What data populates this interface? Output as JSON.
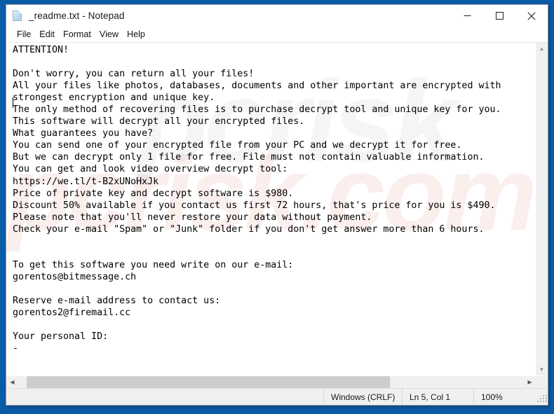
{
  "window": {
    "title": "_readme.txt - Notepad",
    "icon": "notepad-document-icon",
    "controls": {
      "minimize_label": "Minimize",
      "maximize_label": "Maximize",
      "close_label": "Close"
    }
  },
  "menu": {
    "items": [
      {
        "label": "File"
      },
      {
        "label": "Edit"
      },
      {
        "label": "Format"
      },
      {
        "label": "View"
      },
      {
        "label": "Help"
      }
    ]
  },
  "editor": {
    "watermark": "pcrisk.com",
    "watermark_back": "pcrisk",
    "content": "ATTENTION!\n\nDon't worry, you can return all your files!\nAll your files like photos, databases, documents and other important are encrypted with\nstrongest encryption and unique key.\nThe only method of recovering files is to purchase decrypt tool and unique key for you.\nThis software will decrypt all your encrypted files.\nWhat guarantees you have?\nYou can send one of your encrypted file from your PC and we decrypt it for free.\nBut we can decrypt only 1 file for free. File must not contain valuable information.\nYou can get and look video overview decrypt tool:\nhttps://we.tl/t-B2xUNoHxJk\nPrice of private key and decrypt software is $980.\nDiscount 50% available if you contact us first 72 hours, that's price for you is $490.\nPlease note that you'll never restore your data without payment.\nCheck your e-mail \"Spam\" or \"Junk\" folder if you don't get answer more than 6 hours.\n\n\nTo get this software you need write on our e-mail:\ngorentos@bitmessage.ch\n\nReserve e-mail address to contact us:\ngorentos2@firemail.cc\n\nYour personal ID:\n-",
    "details": {
      "download_url": "https://we.tl/t-B2xUNoHxJk",
      "price_full": "$980",
      "price_discount": "$490",
      "discount_percent": "50%",
      "discount_window": "72 hours",
      "response_window": "6 hours",
      "primary_email": "gorentos@bitmessage.ch",
      "reserve_email": "gorentos2@firemail.cc",
      "personal_id": "-",
      "free_decrypt_files": "1"
    }
  },
  "scrollbars": {
    "vertical": {
      "up_arrow": "scroll-up-icon",
      "down_arrow": "scroll-down-icon"
    },
    "horizontal": {
      "left_arrow": "scroll-left-icon",
      "right_arrow": "scroll-right-icon"
    }
  },
  "status_bar": {
    "line_ending": "Windows (CRLF)",
    "cursor_position": "Ln 5, Col 1",
    "zoom": "100%"
  },
  "colors": {
    "desktop": "#0b5ca8",
    "window_bg": "#ffffff",
    "status_bg": "#f0f0f0",
    "scroll_thumb": "#cdcdcd",
    "close_hover": "#e81123",
    "text": "#000000"
  }
}
